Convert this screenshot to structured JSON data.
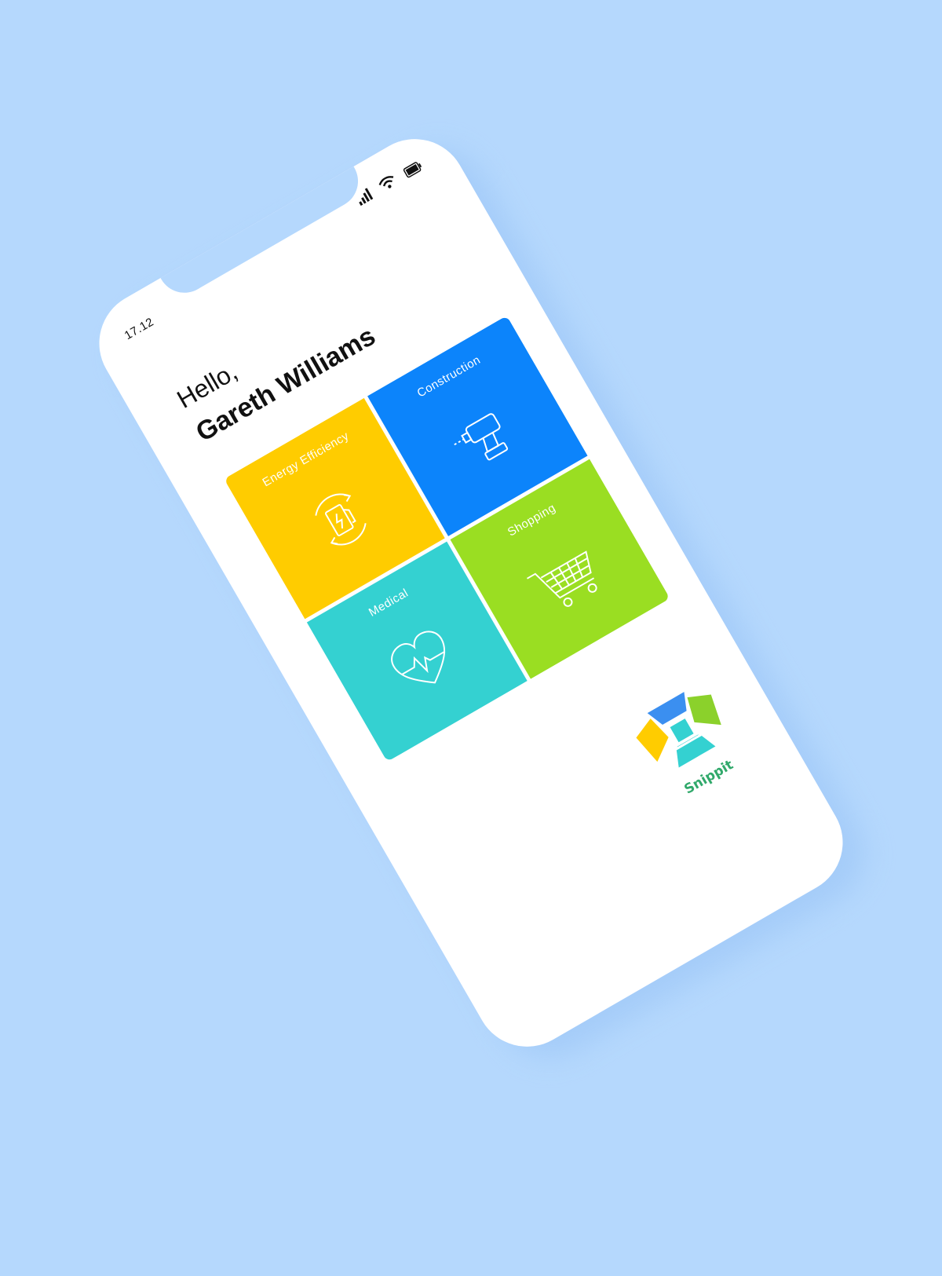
{
  "status_bar": {
    "time": "17.12",
    "icons": [
      "signal-icon",
      "wifi-icon",
      "battery-icon"
    ]
  },
  "greeting": {
    "hello": "Hello,",
    "name": "Gareth Williams"
  },
  "categories": [
    {
      "label": "Energy Efficiency",
      "icon": "charging-station-icon",
      "color": "#ffcc00"
    },
    {
      "label": "Construction",
      "icon": "drill-icon",
      "color": "#0c84fb"
    },
    {
      "label": "Medical",
      "icon": "heartbeat-icon",
      "color": "#34d1d1"
    },
    {
      "label": "Shopping",
      "icon": "shopping-cart-icon",
      "color": "#9ade22"
    }
  ],
  "logo": {
    "text": "Snippit",
    "colors": [
      "#ffcc00",
      "#3b8ff0",
      "#34d1d1",
      "#8bd12b"
    ]
  },
  "colors": {
    "background": "#b5d8fd",
    "phone": "#ffffff"
  }
}
